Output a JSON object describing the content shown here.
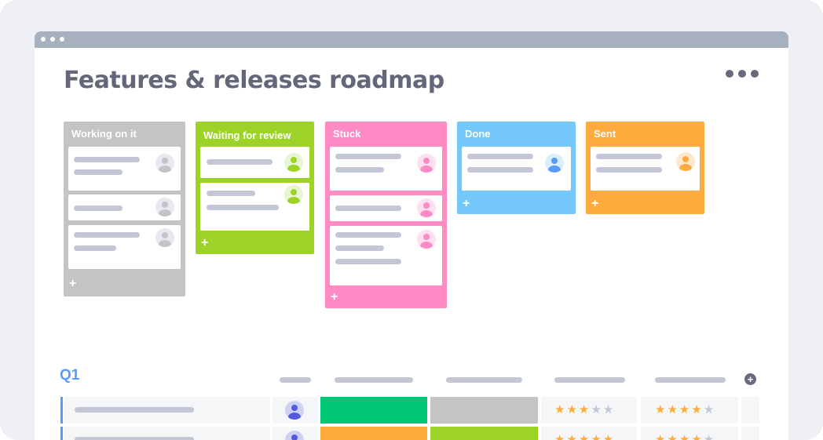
{
  "page": {
    "title": "Features & releases roadmap",
    "more_icon": "more-horizontal-icon"
  },
  "colors": {
    "gray": "#c4c4c4",
    "green": "#9cd326",
    "pink": "#ff8ac4",
    "blue": "#74c8fa",
    "orange": "#fdab3d",
    "status_green": "#00c875",
    "accent_blue": "#579bfc"
  },
  "board": {
    "columns": [
      {
        "label": "Working on it",
        "color": "#c4c4c4",
        "cards": 3,
        "add_label": "+"
      },
      {
        "label": "Waiting for review",
        "color": "#9cd326",
        "cards": 2,
        "add_label": "+"
      },
      {
        "label": "Stuck",
        "color": "#ff8ac4",
        "cards": 3,
        "add_label": "+"
      },
      {
        "label": "Done",
        "color": "#74c8fa",
        "cards": 1,
        "add_label": "+"
      },
      {
        "label": "Sent",
        "color": "#fdab3d",
        "cards": 1,
        "add_label": "+"
      }
    ]
  },
  "table": {
    "group_label": "Q1",
    "add_column_icon": "plus-circle-icon",
    "rows": [
      {
        "status_1": "#00c875",
        "status_2": "#c4c4c4",
        "rating_1": 3,
        "rating_2": 4,
        "max_rating": 5
      },
      {
        "status_1": "#fdab3d",
        "status_2": "#9cd326",
        "rating_1": 5,
        "rating_2": 4,
        "max_rating": 5
      }
    ]
  }
}
